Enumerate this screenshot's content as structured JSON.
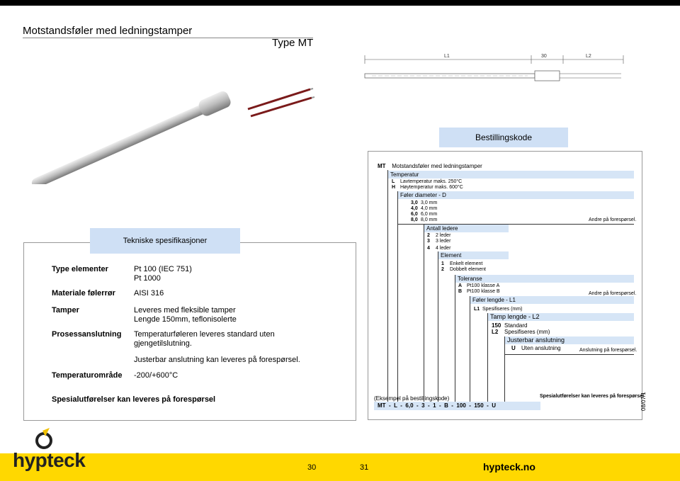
{
  "header": {
    "title": "Motstandsføler med ledningstamper",
    "type": "Type MT"
  },
  "drawing": {
    "dim_l1": "L1",
    "dim_30": "30",
    "dim_l2": "L2"
  },
  "specs": {
    "heading": "Tekniske spesifikasjoner",
    "rows": [
      {
        "label": "Type elementer",
        "value_lines": [
          "Pt 100 (IEC 751)",
          "Pt 1000"
        ]
      },
      {
        "label": "Materiale følerrør",
        "value_lines": [
          "AISI 316"
        ]
      },
      {
        "label": "Tamper",
        "value_lines": [
          "Leveres med fleksible tamper",
          "Lengde 150mm, teflonisolerte"
        ]
      },
      {
        "label": "Prosessanslutning",
        "value_lines": [
          "Temperaturføleren leveres standard uten",
          "gjengetilslutning.",
          "",
          "Justerbar anslutning kan leveres på forespørsel."
        ]
      },
      {
        "label": "Temperaturområde",
        "value_lines": [
          "-200/+600°C"
        ]
      }
    ],
    "footer": "Spesialutførelser kan leveres på forespørsel"
  },
  "order": {
    "heading": "Bestillingskode",
    "mt": "MT",
    "mt_desc": "Motstandsføler med ledningstamper",
    "temp_title": "Temperatur",
    "temp_opts": [
      [
        "L",
        "Lavtemperatur maks. 250°C"
      ],
      [
        "H",
        "Høytemperatur maks. 600°C"
      ]
    ],
    "dia_title": "Føler diameter - D",
    "dia_opts": [
      [
        "3,0",
        "3,0 mm"
      ],
      [
        "4,0",
        "4,0 mm"
      ],
      [
        "6,0",
        "6,0 mm"
      ],
      [
        "8,0",
        "8,0 mm"
      ]
    ],
    "dia_note": "Andre på forespørsel.",
    "wire_title": "Antall ledere",
    "wire_opts": [
      [
        "2",
        "2 leder"
      ],
      [
        "3",
        "3 leder"
      ],
      [
        "4",
        "4 leder"
      ]
    ],
    "elem_title": "Element",
    "elem_opts": [
      [
        "1",
        "Enkelt element"
      ],
      [
        "2",
        "Dobbelt element"
      ]
    ],
    "tol_title": "Toleranse",
    "tol_opts": [
      [
        "A",
        "Pt100 klasse A"
      ],
      [
        "B",
        "Pt100 klasse B"
      ]
    ],
    "tol_note": "Andre på forespørsel.",
    "len_title": "Føler lengde - L1",
    "len_opts": [
      [
        "L1",
        "Spesifiseres (mm)"
      ]
    ],
    "tamp_title": "Tamp lengde - L2",
    "tamp_opts": [
      [
        "150",
        "Standard"
      ],
      [
        "L2",
        "Spesifiseres (mm)"
      ]
    ],
    "adj_title": "Justerbar anslutning",
    "adj_opts": [
      [
        "U",
        "Uten anslutning"
      ]
    ],
    "adj_note": "Anslutning på forespørsel.",
    "example_title": "(Eksempel på bestillingskode)",
    "example_code": "MT  -  L  -  6,0  -  3  -  1  -  B  -  100  -  150  -  U",
    "special": "Spesialutførelser kan leveres på forespørsel",
    "date": "08/07/1"
  },
  "footer": {
    "logo": "hypteck",
    "page_left": "30",
    "page_right": "31",
    "brand": "hypteck.no"
  },
  "colors": {
    "accent_yellow": "#ffd800",
    "heading_blue": "#cfe0f5"
  }
}
